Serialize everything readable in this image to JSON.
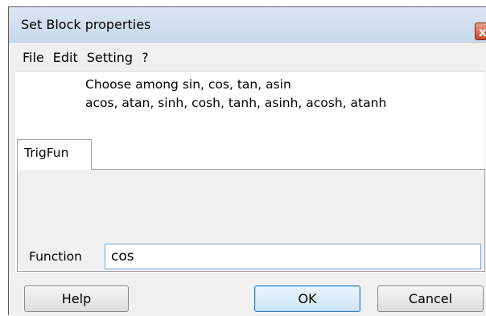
{
  "window": {
    "title": "Set Block properties",
    "close_glyph": "x"
  },
  "menu": {
    "items": [
      "File",
      "Edit",
      "Setting",
      "?"
    ]
  },
  "description": {
    "line1": "Choose among sin, cos, tan, asin",
    "line2": "acos, atan, sinh, cosh, tanh, asinh, acosh, atanh"
  },
  "tabs": [
    {
      "label": "TrigFun",
      "selected": true
    }
  ],
  "form": {
    "function_label": "Function",
    "function_value": "cos"
  },
  "buttons": {
    "help": "Help",
    "ok": "OK",
    "cancel": "Cancel"
  },
  "colors": {
    "title_gradient_top": "#dbe6f3",
    "close_red": "#c74a2a",
    "input_border": "#7aa3d0",
    "default_button_border": "#3c7fb1"
  }
}
